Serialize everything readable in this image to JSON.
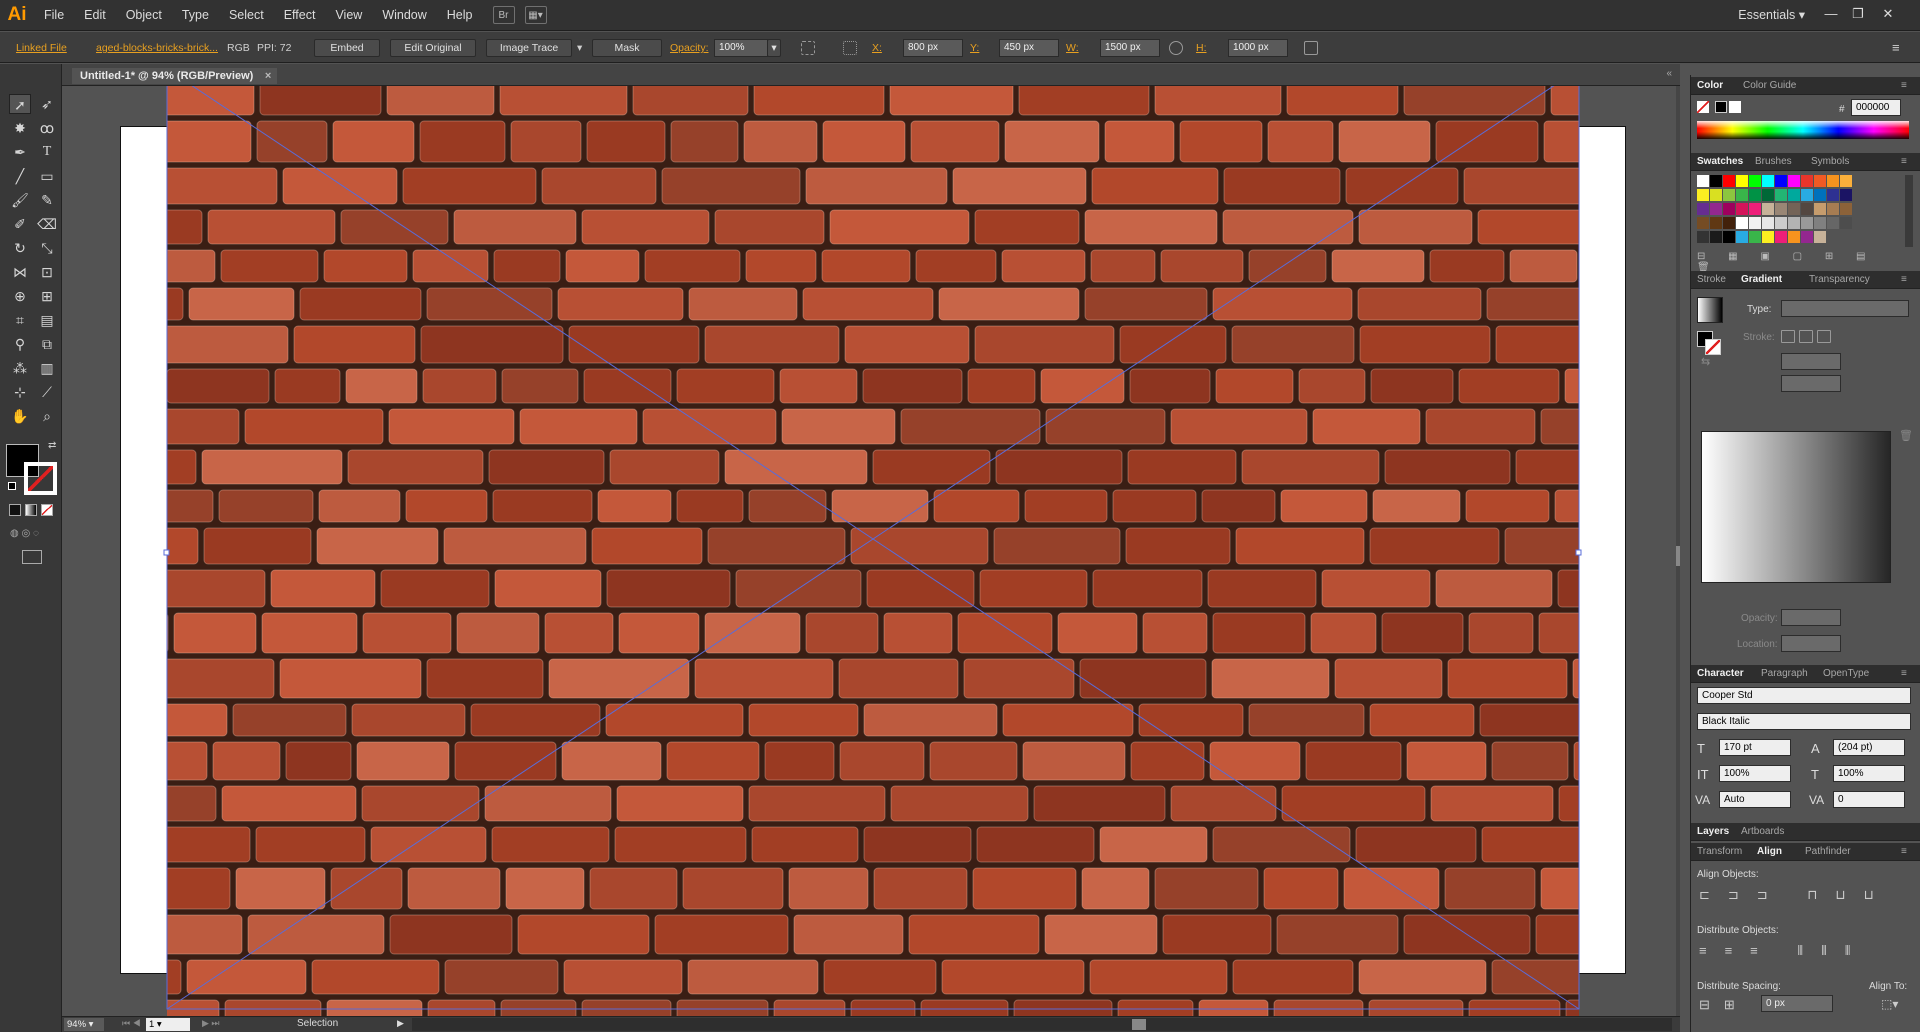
{
  "app": {
    "logo": "Ai"
  },
  "menu": [
    "File",
    "Edit",
    "Object",
    "Type",
    "Select",
    "Effect",
    "View",
    "Window",
    "Help"
  ],
  "workspace": "Essentials",
  "control_bar": {
    "linked_file": "Linked File",
    "file_name": "aged-blocks-bricks-brick...",
    "color_mode": "RGB",
    "ppi": "PPI: 72",
    "embed": "Embed",
    "edit_original": "Edit Original",
    "image_trace": "Image Trace",
    "mask": "Mask",
    "opacity_label": "Opacity:",
    "opacity": "100%",
    "x_label": "X:",
    "x": "800 px",
    "y_label": "Y:",
    "y": "450 px",
    "w_label": "W:",
    "w": "1500 px",
    "h_label": "H:",
    "h": "1000 px"
  },
  "document": {
    "tab_title": "Untitled-1* @ 94% (RGB/Preview)"
  },
  "status": {
    "zoom": "94%",
    "page": "1",
    "tool": "Selection"
  },
  "colors": {
    "accent": "#e8a020",
    "selection": "#5a6cd8"
  },
  "panels": {
    "color": {
      "tabs": [
        "Color",
        "Color Guide"
      ],
      "hex_label": "#",
      "hex": "000000"
    },
    "swatches": {
      "tabs": [
        "Swatches",
        "Brushes",
        "Symbols"
      ]
    },
    "gradient": {
      "tabs": [
        "Stroke",
        "Gradient",
        "Transparency"
      ],
      "type_label": "Type:",
      "stroke_label": "Stroke:",
      "opacity_label": "Opacity:",
      "location_label": "Location:"
    },
    "character": {
      "tabs": [
        "Character",
        "Paragraph",
        "OpenType"
      ],
      "font": "Cooper Std",
      "style": "Black Italic",
      "size": "170 pt",
      "leading": "(204 pt)",
      "vscale": "100%",
      "hscale": "100%",
      "kerning": "Auto",
      "tracking": "0"
    },
    "layers": {
      "tabs": [
        "Layers",
        "Artboards"
      ]
    },
    "align": {
      "tabs": [
        "Transform",
        "Align",
        "Pathfinder"
      ],
      "align_objects": "Align Objects:",
      "distribute_objects": "Distribute Objects:",
      "distribute_spacing": "Distribute Spacing:",
      "align_to": "Align To:",
      "spacing": "0 px"
    }
  }
}
